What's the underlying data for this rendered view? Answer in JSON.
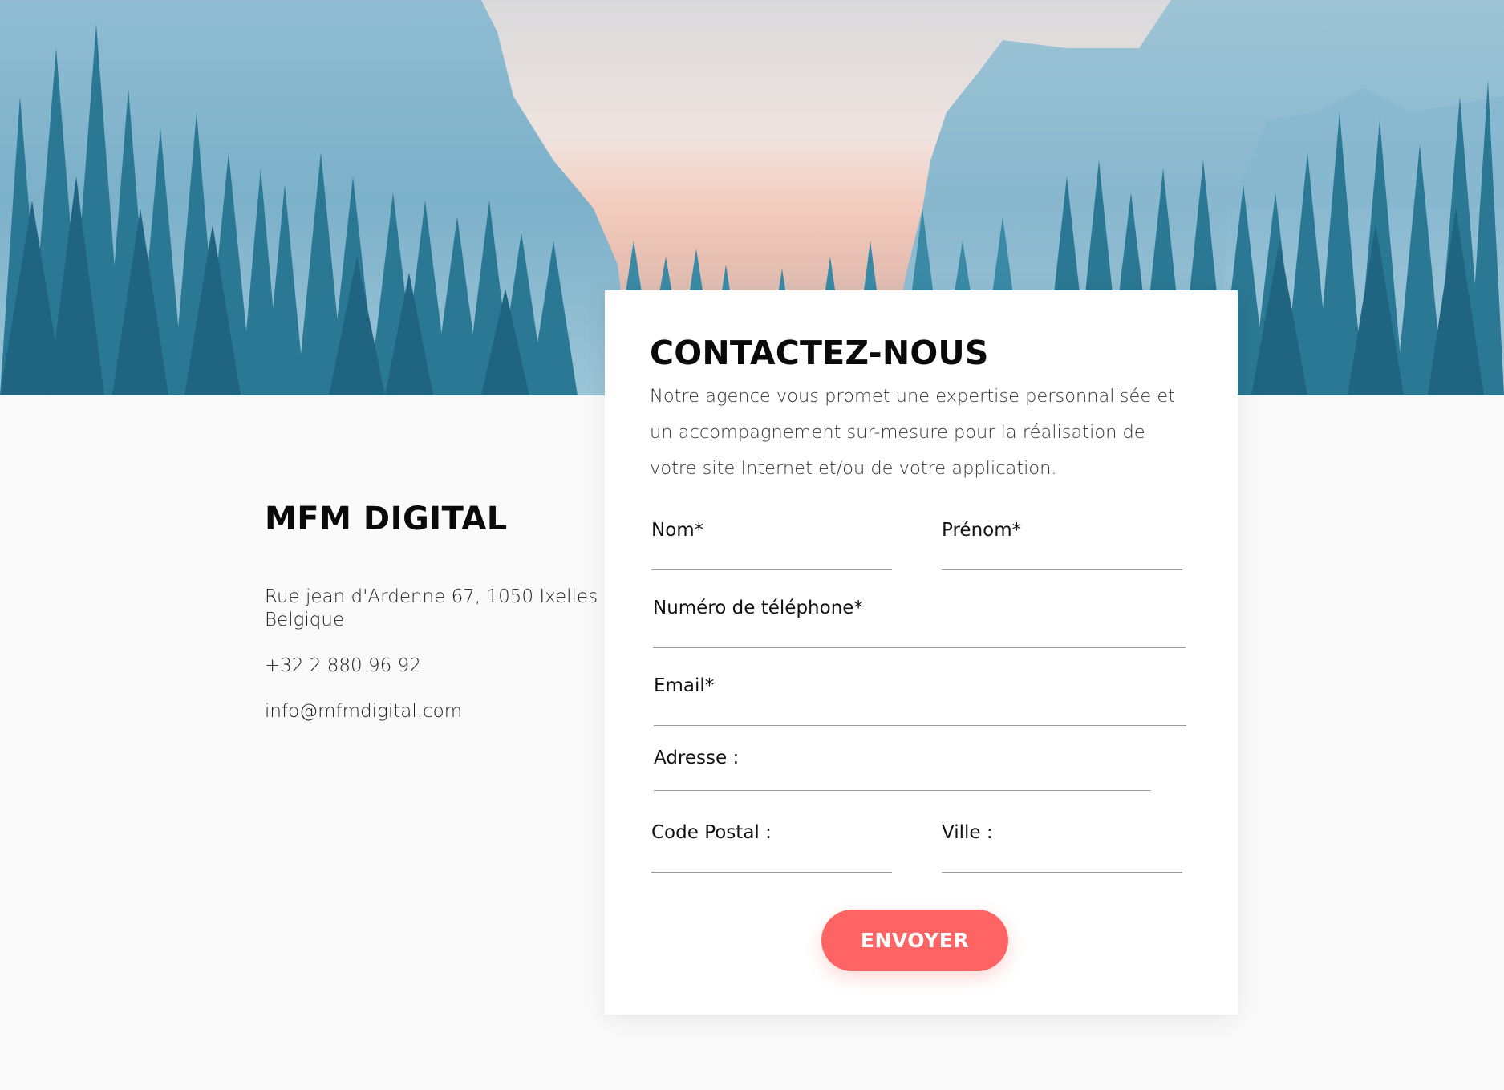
{
  "hero": {
    "colors": {
      "sky_top": "#dcdcdc",
      "sky_glow": "#f6a58e",
      "mountain": "#7fb1c9",
      "trees_dark": "#1f5f78",
      "trees_mid": "#2b7a96"
    }
  },
  "company": {
    "name": "MFM DIGITAL",
    "address_line1": "Rue jean d'Ardenne 67, 1050 Ixelles",
    "address_line2": "Belgique",
    "phone": "+32 2 880 96 92",
    "email": "info@mfmdigital.com"
  },
  "contact_form": {
    "title": "CONTACTEZ-NOUS",
    "description": "Notre agence vous promet une expertise personnalisée et un accompagnement sur-mesure pour la réalisation de votre site Internet et/ou de votre application.",
    "fields": {
      "nom": {
        "label": "Nom*",
        "value": ""
      },
      "prenom": {
        "label": "Prénom*",
        "value": ""
      },
      "telephone": {
        "label": "Numéro de téléphone*",
        "value": ""
      },
      "email": {
        "label": "Email*",
        "value": ""
      },
      "adresse": {
        "label": "Adresse :",
        "value": ""
      },
      "code_postal": {
        "label": "Code Postal :",
        "value": ""
      },
      "ville": {
        "label": "Ville :",
        "value": ""
      }
    },
    "submit_label": "ENVOYER",
    "accent_color": "#ff6464"
  }
}
